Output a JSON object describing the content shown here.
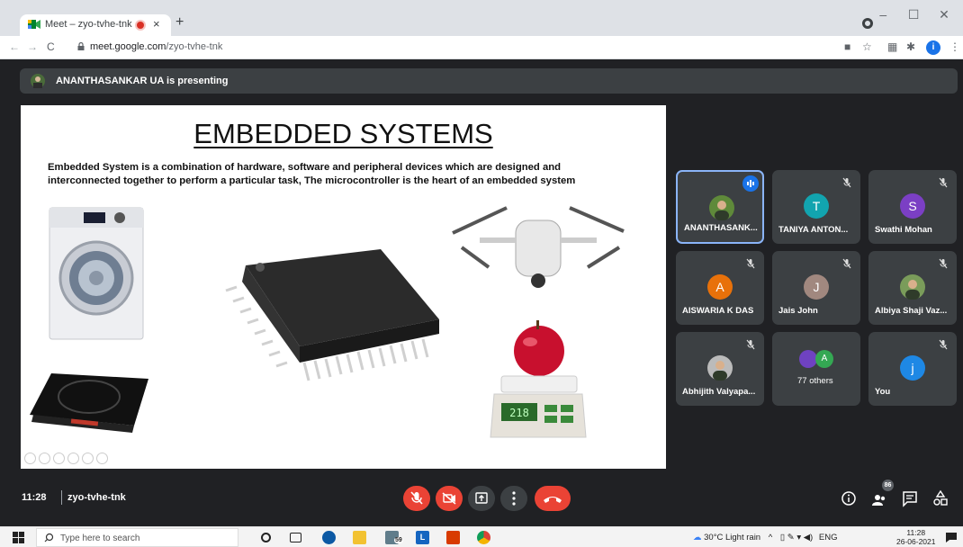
{
  "browser": {
    "tab_title": "Meet – zyo-tvhe-tnk",
    "tab_close": "×",
    "new_tab": "+",
    "url_domain": "meet.google.com",
    "url_path": "/zyo-tvhe-tnk",
    "profile_initial": "i",
    "window_min": "–",
    "window_max": "☐",
    "window_close": "✕"
  },
  "meet": {
    "presenting_banner": "ANANTHASANKAR UA is presenting",
    "time": "11:28",
    "meeting_code": "zyo-tvhe-tnk",
    "participants_count": "86"
  },
  "slide": {
    "title": "EMBEDDED SYSTEMS",
    "body": "Embedded  System is a combination of hardware, software and peripheral devices which are designed and interconnected together to perform a particular task, The microcontroller is the heart of an embedded system",
    "scale_display": "218"
  },
  "participants": [
    {
      "name": "ANANTHASANK...",
      "initial": "",
      "color": "#5f8a3a",
      "photo": true,
      "speaking": true
    },
    {
      "name": "TANIYA ANTON...",
      "initial": "T",
      "color": "#12a4af"
    },
    {
      "name": "Swathi Mohan",
      "initial": "S",
      "color": "#7b3fc4"
    },
    {
      "name": "AISWARIA K DAS",
      "initial": "A",
      "color": "#e8710a"
    },
    {
      "name": "Jais John",
      "initial": "J",
      "color": "#a1887f"
    },
    {
      "name": "Albiya Shaji Vaz...",
      "initial": "",
      "color": "#7a9c5a",
      "photo": true
    },
    {
      "name": "Abhijith Valyapa...",
      "initial": "",
      "color": "#bbbbbb",
      "photo": true
    },
    {
      "name": "77 others",
      "initial": "A",
      "color": "#34a853"
    },
    {
      "name": "You",
      "initial": "j",
      "color": "#1e88e5"
    }
  ],
  "taskbar": {
    "search_placeholder": "Type here to search",
    "weather": "30°C  Light rain",
    "language": "ENG",
    "clock_time": "11:28",
    "clock_date": "26-06-2021",
    "badge": "59"
  },
  "colors": {
    "meet_bg": "#202124",
    "tile_bg": "#3c4043",
    "control_red": "#ea4335",
    "control_gray": "#3c4043",
    "active_border": "#8ab4f8"
  }
}
